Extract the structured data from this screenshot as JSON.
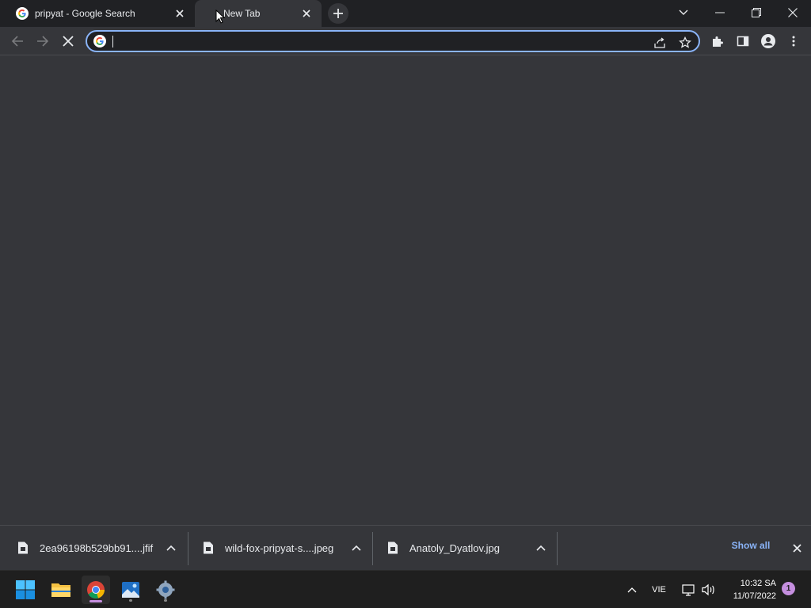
{
  "browser": {
    "tabs": [
      {
        "title": "pripyat - Google Search",
        "favicon": "google-g-icon",
        "active": false
      },
      {
        "title": "New Tab",
        "favicon": "loading-icon",
        "active": true
      }
    ],
    "omnibox": {
      "value": "",
      "placeholder": ""
    }
  },
  "downloads": {
    "items": [
      {
        "filename": "2ea96198b529bb91....jfif",
        "icon": "file-icon"
      },
      {
        "filename": "wild-fox-pripyat-s....jpeg",
        "icon": "file-icon"
      },
      {
        "filename": "Anatoly_Dyatlov.jpg",
        "icon": "file-icon"
      }
    ],
    "show_all_label": "Show all"
  },
  "taskbar": {
    "language": "VIE",
    "time": "10:32 SA",
    "date": "11/07/2022",
    "notification_count": "1"
  },
  "colors": {
    "accent": "#8ab4f8",
    "background": "#35363a",
    "tabstrip": "#202124",
    "taskbar": "#1f1f1f",
    "indicator": "#c58fdf"
  }
}
